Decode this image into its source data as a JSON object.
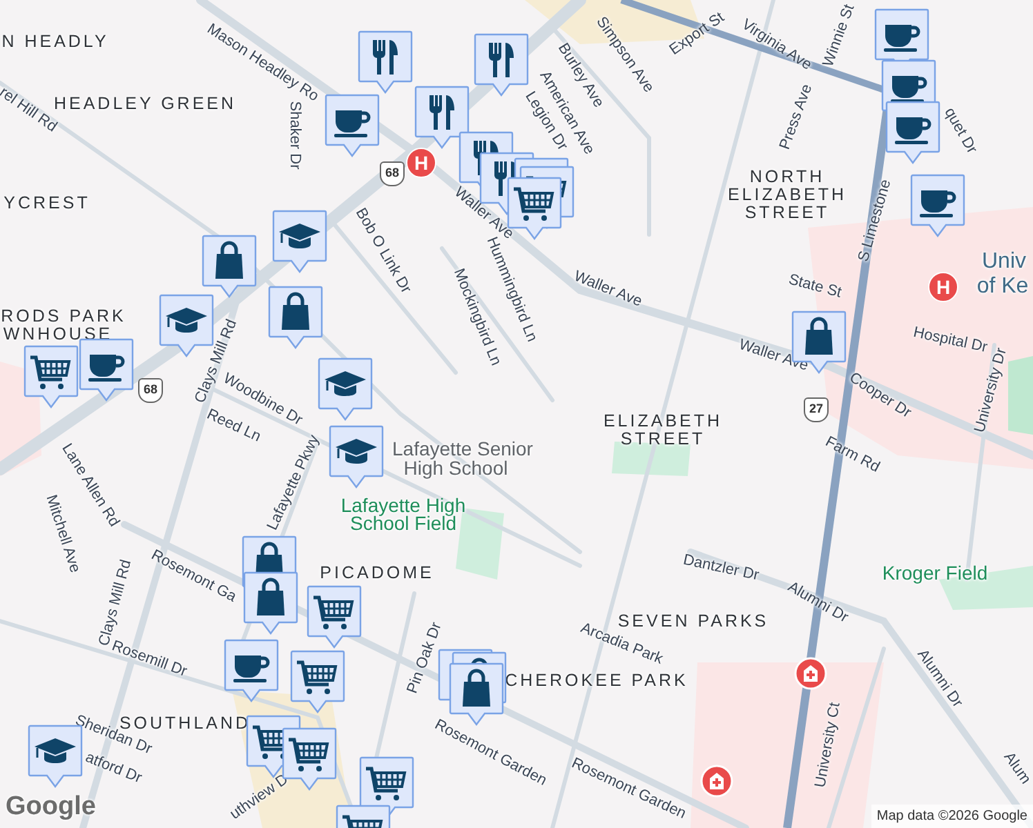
{
  "map": {
    "labels": [
      {
        "text": "N HEADLY",
        "kind": "area"
      },
      {
        "text": "HEADLEY GREEN",
        "kind": "area"
      },
      {
        "text": "YCREST",
        "kind": "area"
      },
      {
        "text": "RODS PARK",
        "kind": "area"
      },
      {
        "text": "WNHOUSE",
        "kind": "area"
      },
      {
        "text": "NORTH",
        "kind": "area"
      },
      {
        "text": "ELIZABETH",
        "kind": "area"
      },
      {
        "text": "STREET",
        "kind": "area"
      },
      {
        "text": "ELIZABETH",
        "kind": "area"
      },
      {
        "text": "STREET",
        "kind": "area"
      },
      {
        "text": "PICADOME",
        "kind": "area"
      },
      {
        "text": "SEVEN PARKS",
        "kind": "area"
      },
      {
        "text": "CHEROKEE PARK",
        "kind": "area"
      },
      {
        "text": "SOUTHLAND",
        "kind": "area"
      },
      {
        "text": "Lafayette Senior",
        "kind": "school"
      },
      {
        "text": "High School",
        "kind": "school"
      },
      {
        "text": "Lafayette High",
        "kind": "park"
      },
      {
        "text": "School Field",
        "kind": "park"
      },
      {
        "text": "Kroger Field",
        "kind": "park"
      },
      {
        "text": "Univ",
        "kind": "campus"
      },
      {
        "text": "of Ke",
        "kind": "campus"
      },
      {
        "text": "rel Hill Rd",
        "kind": "street"
      },
      {
        "text": "Mason Headley Ro",
        "kind": "street"
      },
      {
        "text": "Shaker Dr",
        "kind": "street"
      },
      {
        "text": "Bob O Link Dr",
        "kind": "street"
      },
      {
        "text": "Waller Ave",
        "kind": "street"
      },
      {
        "text": "Hummingbird Ln",
        "kind": "street"
      },
      {
        "text": "Mockingbird Ln",
        "kind": "street"
      },
      {
        "text": "Legion Dr",
        "kind": "street"
      },
      {
        "text": "American Ave",
        "kind": "street"
      },
      {
        "text": "Burley Ave",
        "kind": "street"
      },
      {
        "text": "Simpson Ave",
        "kind": "street"
      },
      {
        "text": "Export St",
        "kind": "street"
      },
      {
        "text": "Virginia Ave",
        "kind": "street"
      },
      {
        "text": "Winnie St",
        "kind": "street"
      },
      {
        "text": "Press Ave",
        "kind": "street"
      },
      {
        "text": "S Limestone",
        "kind": "street"
      },
      {
        "text": "quet Dr",
        "kind": "street"
      },
      {
        "text": "Waller Ave",
        "kind": "street"
      },
      {
        "text": "State St",
        "kind": "street"
      },
      {
        "text": "Hospital Dr",
        "kind": "street"
      },
      {
        "text": "Waller Ave",
        "kind": "street"
      },
      {
        "text": "Cooper Dr",
        "kind": "street"
      },
      {
        "text": "University Dr",
        "kind": "street"
      },
      {
        "text": "Farm Rd",
        "kind": "street"
      },
      {
        "text": "Clays Mill Rd",
        "kind": "street"
      },
      {
        "text": "Woodbine Dr",
        "kind": "street"
      },
      {
        "text": "Reed Ln",
        "kind": "street"
      },
      {
        "text": "Lafayette Pkwy",
        "kind": "street"
      },
      {
        "text": "Lane Allen Rd",
        "kind": "street"
      },
      {
        "text": "Mitchell Ave",
        "kind": "street"
      },
      {
        "text": "Clays Mill Rd",
        "kind": "street"
      },
      {
        "text": "Rosemont Ga",
        "kind": "street"
      },
      {
        "text": "Rosemont Garden",
        "kind": "street"
      },
      {
        "text": "Rosemont Garden",
        "kind": "street"
      },
      {
        "text": "Rosemill Dr",
        "kind": "street"
      },
      {
        "text": "Sheridan Dr",
        "kind": "street"
      },
      {
        "text": "atford Dr",
        "kind": "street"
      },
      {
        "text": "uthview D",
        "kind": "street"
      },
      {
        "text": "Pin Oak Dr",
        "kind": "street"
      },
      {
        "text": "Dantzler Dr",
        "kind": "street"
      },
      {
        "text": "Alumni Dr",
        "kind": "street"
      },
      {
        "text": "Alumni Dr",
        "kind": "street"
      },
      {
        "text": "Arcadia Park",
        "kind": "street"
      },
      {
        "text": "University Ct",
        "kind": "street"
      },
      {
        "text": "Alum",
        "kind": "street"
      }
    ],
    "shields": [
      "68",
      "68",
      "27"
    ],
    "markers": [
      {
        "kind": "restaurant"
      },
      {
        "kind": "restaurant"
      },
      {
        "kind": "restaurant"
      },
      {
        "kind": "restaurant"
      },
      {
        "kind": "restaurant"
      },
      {
        "kind": "grocery"
      },
      {
        "kind": "grocery"
      },
      {
        "kind": "grocery"
      },
      {
        "kind": "cafe"
      },
      {
        "kind": "cafe"
      },
      {
        "kind": "cafe"
      },
      {
        "kind": "cafe"
      },
      {
        "kind": "cafe"
      },
      {
        "kind": "school"
      },
      {
        "kind": "shopping"
      },
      {
        "kind": "shopping"
      },
      {
        "kind": "school"
      },
      {
        "kind": "school"
      },
      {
        "kind": "grocery"
      },
      {
        "kind": "cafe"
      },
      {
        "kind": "shopping"
      },
      {
        "kind": "school"
      },
      {
        "kind": "shopping"
      },
      {
        "kind": "shopping"
      },
      {
        "kind": "grocery"
      },
      {
        "kind": "grocery"
      },
      {
        "kind": "cafe"
      },
      {
        "kind": "shopping"
      },
      {
        "kind": "shopping"
      },
      {
        "kind": "shopping"
      },
      {
        "kind": "grocery"
      },
      {
        "kind": "grocery"
      },
      {
        "kind": "school"
      },
      {
        "kind": "grocery"
      },
      {
        "kind": "grocery"
      }
    ],
    "hospitals": [
      {
        "kind": "hospital",
        "label": "H"
      },
      {
        "kind": "hospital",
        "label": "H"
      },
      {
        "kind": "medical"
      },
      {
        "kind": "medical"
      }
    ],
    "logo": "Google",
    "attribution": "Map data ©2026 Google"
  }
}
